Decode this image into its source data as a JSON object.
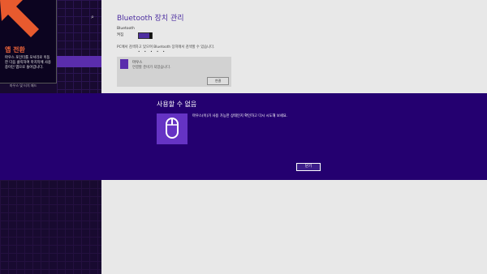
{
  "tip": {
    "title": "앱 전환",
    "text": "마우스 포인터를 모서리로 이동한 다음 클릭하여 마지막에 사용 중이던 앱으로 돌아갑니다."
  },
  "nav": {
    "link": "마우스 및 터치 패드"
  },
  "settings": {
    "title": "Bluetooth 장치 관리",
    "bluetooth_label": "Bluetooth",
    "bluetooth_state": "켜짐",
    "description": "PC에서 검색하고 있으며 Bluetooth 장치에서 검색할 수 있습니다.",
    "dots": "•  •  • • •",
    "device_name": "마우스",
    "device_status": "연결할 준비가 되었습니다.",
    "device_button": "연결"
  },
  "dialog": {
    "title": "사용할 수 없음",
    "message": "마우스(이)가 사용 가능한 상태인지 확인하고 다시 시도해 보세요.",
    "close_button": "닫기"
  },
  "colors": {
    "accent": "#4d2ea0",
    "dialog_bg": "#240070",
    "tip_title": "#f0653a"
  },
  "icons": {
    "search": "search-icon",
    "device": "mouse-icon",
    "dialog": "mouse-icon",
    "tip": "arrow-corner-icon"
  }
}
